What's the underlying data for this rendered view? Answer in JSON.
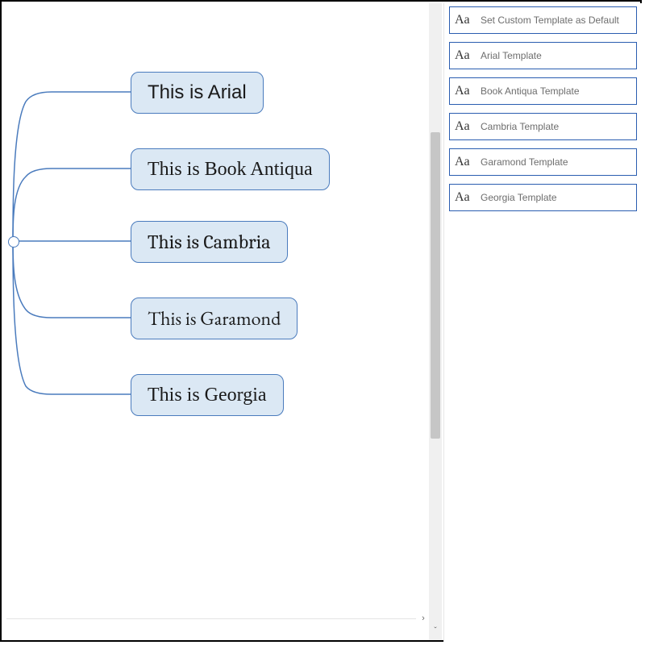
{
  "colors": {
    "node_border": "#4a7bbd",
    "node_fill": "#dbe8f4",
    "panel_border": "#2a5db0",
    "panel_text": "#6d6d6d"
  },
  "canvas": {
    "nodes": [
      {
        "label": "This is Arial",
        "font": "Arial"
      },
      {
        "label": "This is Book Antiqua",
        "font": "Book Antiqua"
      },
      {
        "label": "This is Cambria",
        "font": "Cambria"
      },
      {
        "label": "This is Garamond",
        "font": "Garamond"
      },
      {
        "label": "This is Georgia",
        "font": "Georgia"
      }
    ]
  },
  "panel": {
    "aa_glyph": "Aa",
    "templates": [
      {
        "label": "Set Custom Template as Default"
      },
      {
        "label": "Arial Template"
      },
      {
        "label": "Book Antiqua Template"
      },
      {
        "label": "Cambria Template"
      },
      {
        "label": "Garamond Template"
      },
      {
        "label": "Georgia Template"
      }
    ]
  }
}
